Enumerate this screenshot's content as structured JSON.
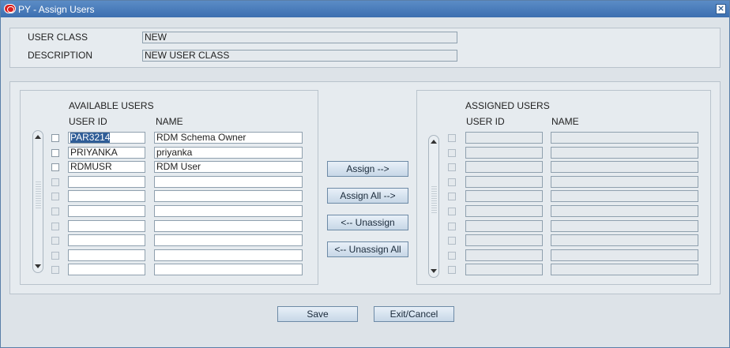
{
  "window": {
    "title": "PY - Assign Users"
  },
  "header": {
    "user_class_label": "USER CLASS",
    "user_class_value": "NEW",
    "description_label": "DESCRIPTION",
    "description_value": "NEW USER CLASS"
  },
  "available": {
    "heading": "AVAILABLE USERS",
    "col_user_id": "USER ID",
    "col_name": "NAME",
    "rows": [
      {
        "user_id": "PAR3214",
        "name": "RDM Schema Owner"
      },
      {
        "user_id": "PRIYANKA",
        "name": "priyanka"
      },
      {
        "user_id": "RDMUSR",
        "name": "RDM User"
      },
      {
        "user_id": "",
        "name": ""
      },
      {
        "user_id": "",
        "name": ""
      },
      {
        "user_id": "",
        "name": ""
      },
      {
        "user_id": "",
        "name": ""
      },
      {
        "user_id": "",
        "name": ""
      },
      {
        "user_id": "",
        "name": ""
      },
      {
        "user_id": "",
        "name": ""
      }
    ]
  },
  "assigned": {
    "heading": "ASSIGNED USERS",
    "col_user_id": "USER ID",
    "col_name": "NAME",
    "rows": [
      {
        "user_id": "",
        "name": ""
      },
      {
        "user_id": "",
        "name": ""
      },
      {
        "user_id": "",
        "name": ""
      },
      {
        "user_id": "",
        "name": ""
      },
      {
        "user_id": "",
        "name": ""
      },
      {
        "user_id": "",
        "name": ""
      },
      {
        "user_id": "",
        "name": ""
      },
      {
        "user_id": "",
        "name": ""
      },
      {
        "user_id": "",
        "name": ""
      },
      {
        "user_id": "",
        "name": ""
      }
    ]
  },
  "actions": {
    "assign": "Assign -->",
    "assign_all": "Assign All -->",
    "unassign": "<-- Unassign",
    "unassign_all": "<-- Unassign All"
  },
  "footer": {
    "save": "Save",
    "exit": "Exit/Cancel"
  },
  "colors": {
    "titlebar": "#3c6fb0",
    "selection": "#2f5d97",
    "button_border": "#6d8aa6"
  }
}
